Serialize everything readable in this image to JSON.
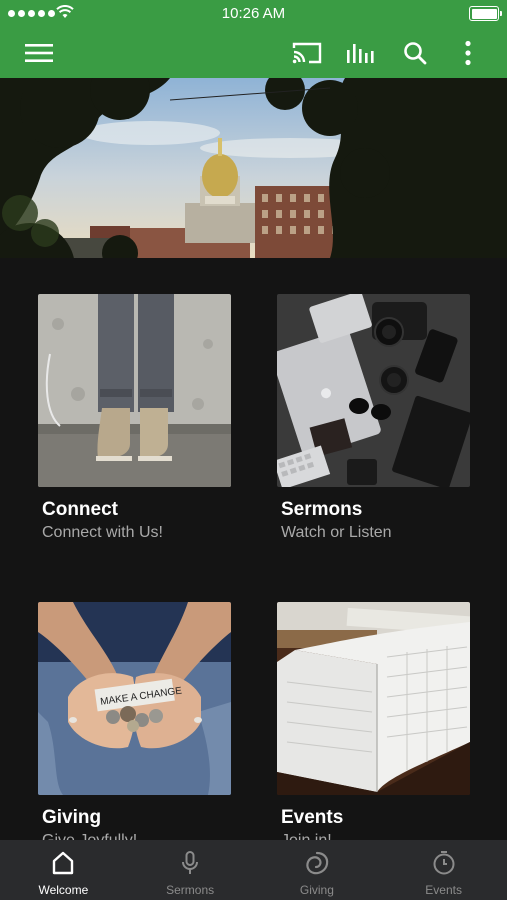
{
  "status_bar": {
    "time": "10:26 AM"
  },
  "toolbar": {
    "icons": [
      "menu-icon",
      "cast-icon",
      "audio-bars-icon",
      "search-icon",
      "more-vert-icon"
    ]
  },
  "cards": [
    {
      "title": "Connect",
      "subtitle": "Connect with Us!"
    },
    {
      "title": "Sermons",
      "subtitle": "Watch or Listen"
    },
    {
      "title": "Giving",
      "subtitle": "Give Joyfully!"
    },
    {
      "title": "Events",
      "subtitle": "Join in!"
    }
  ],
  "coin_note": "MAKE A CHANGE",
  "bottom_nav": [
    {
      "label": "Welcome",
      "active": true
    },
    {
      "label": "Sermons",
      "active": false
    },
    {
      "label": "Giving",
      "active": false
    },
    {
      "label": "Events",
      "active": false
    }
  ],
  "colors": {
    "brand_green": "#3a9c44",
    "background": "#141414",
    "nav_bg": "#2a2b2d"
  }
}
